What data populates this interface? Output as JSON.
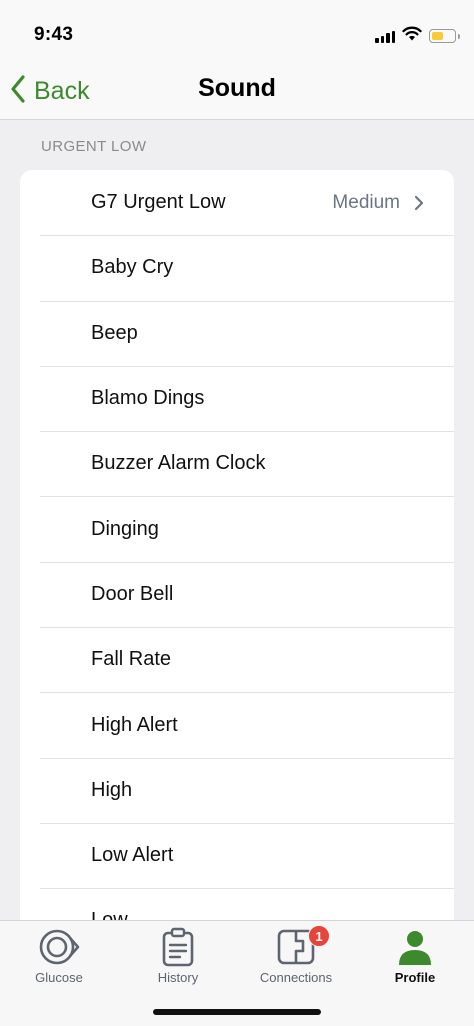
{
  "status_bar": {
    "time": "9:43"
  },
  "nav": {
    "back_label": "Back",
    "title": "Sound"
  },
  "section": {
    "header": "URGENT LOW"
  },
  "list": {
    "items": [
      {
        "label": "G7 Urgent Low",
        "value": "Medium"
      },
      {
        "label": "Baby Cry"
      },
      {
        "label": "Beep"
      },
      {
        "label": "Blamo Dings"
      },
      {
        "label": "Buzzer Alarm Clock"
      },
      {
        "label": "Dinging"
      },
      {
        "label": "Door Bell"
      },
      {
        "label": "Fall Rate"
      },
      {
        "label": "High Alert"
      },
      {
        "label": "High"
      },
      {
        "label": "Low Alert"
      },
      {
        "label": "Low"
      }
    ]
  },
  "tab_bar": {
    "tabs": [
      {
        "label": "Glucose",
        "icon": "glucose-icon"
      },
      {
        "label": "History",
        "icon": "history-icon"
      },
      {
        "label": "Connections",
        "icon": "connections-icon",
        "badge": "1"
      },
      {
        "label": "Profile",
        "icon": "profile-icon",
        "active": true
      }
    ]
  },
  "colors": {
    "accent_green": "#3d8a2c",
    "badge_red": "#e5453b",
    "battery_yellow": "#f7cc38",
    "background": "#efeff1"
  }
}
